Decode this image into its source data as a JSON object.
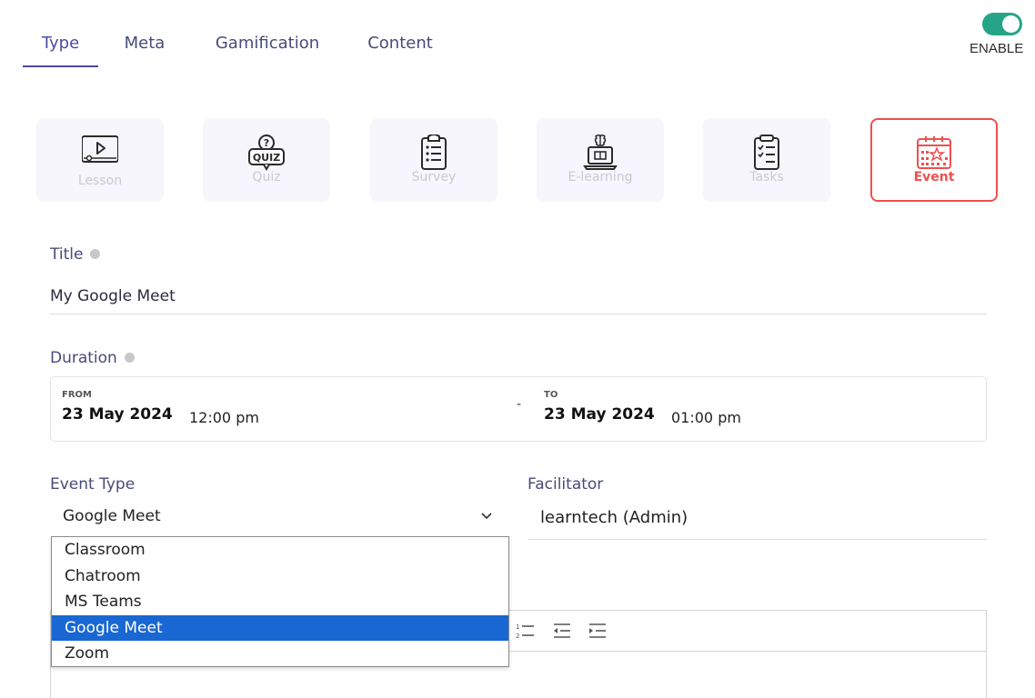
{
  "tabs": [
    {
      "label": "Type",
      "active": true
    },
    {
      "label": "Meta",
      "active": false
    },
    {
      "label": "Gamification",
      "active": false
    },
    {
      "label": "Content",
      "active": false
    }
  ],
  "toggle": {
    "label": "ENABLE",
    "on": true,
    "color": "#26a488"
  },
  "types": [
    {
      "label": "Lesson",
      "icon": "video-lesson-icon",
      "selected": false
    },
    {
      "label": "Quiz",
      "icon": "quiz-bubble-icon",
      "selected": false
    },
    {
      "label": "Survey",
      "icon": "clipboard-list-icon",
      "selected": false
    },
    {
      "label": "E-learning",
      "icon": "laptop-brain-icon",
      "selected": false
    },
    {
      "label": "Tasks",
      "icon": "clipboard-check-icon",
      "selected": false
    },
    {
      "label": "Event",
      "icon": "calendar-star-icon",
      "selected": true
    }
  ],
  "title": {
    "label": "Title",
    "value": "My Google Meet"
  },
  "duration": {
    "label": "Duration",
    "from": {
      "label": "FROM",
      "date": "23 May 2024",
      "time": "12:00 pm"
    },
    "separator": "-",
    "to": {
      "label": "TO",
      "date": "23 May 2024",
      "time": "01:00 pm"
    }
  },
  "event_type": {
    "label": "Event Type",
    "value": "Google Meet",
    "options": [
      "Classroom",
      "Chatroom",
      "MS Teams",
      "Google Meet",
      "Zoom"
    ],
    "selected_index": 3
  },
  "facilitator": {
    "label": "Facilitator",
    "value": "learntech (Admin)"
  },
  "editor": {
    "toolbar_icons": [
      "ordered-list-icon",
      "outdent-icon",
      "indent-icon"
    ]
  },
  "colors": {
    "accent": "#4c4ba6",
    "event_red": "#ef4f4f",
    "dropdown_highlight": "#1967d2"
  }
}
